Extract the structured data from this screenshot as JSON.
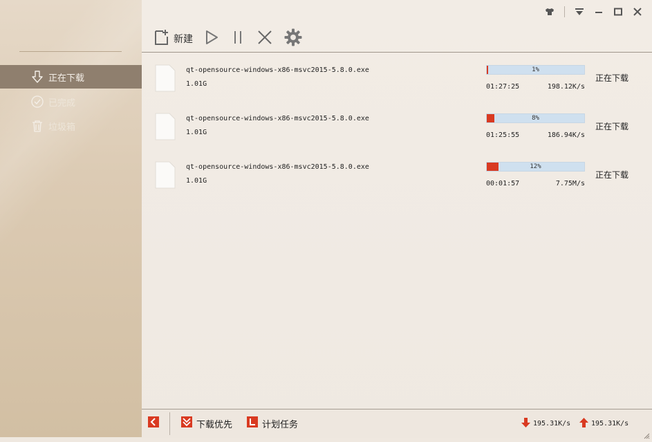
{
  "sidebar": {
    "items": [
      {
        "label": "正在下载",
        "icon": "download-icon",
        "active": true
      },
      {
        "label": "已完成",
        "icon": "check-circle-icon",
        "active": false
      },
      {
        "label": "垃圾箱",
        "icon": "trash-icon",
        "active": false
      }
    ]
  },
  "toolbar": {
    "new_label": "新建",
    "icons": [
      "new-file-icon",
      "play-icon",
      "pause-icon",
      "delete-icon",
      "gear-icon"
    ]
  },
  "window_controls": [
    "skin-icon",
    "menu-icon",
    "minimize-icon",
    "maximize-icon",
    "close-icon"
  ],
  "downloads": [
    {
      "name": "qt-opensource-windows-x86-msvc2015-5.8.0.exe",
      "size": "1.01G",
      "progress_pct": 1,
      "progress_label": "1%",
      "time": "01:27:25",
      "speed": "198.12K/s",
      "status": "正在下载"
    },
    {
      "name": "qt-opensource-windows-x86-msvc2015-5.8.0.exe",
      "size": "1.01G",
      "progress_pct": 8,
      "progress_label": "8%",
      "time": "01:25:55",
      "speed": "186.94K/s",
      "status": "正在下载"
    },
    {
      "name": "qt-opensource-windows-x86-msvc2015-5.8.0.exe",
      "size": "1.01G",
      "progress_pct": 12,
      "progress_label": "12%",
      "time": "00:01:57",
      "speed": "7.75M/s",
      "status": "正在下载"
    }
  ],
  "footer": {
    "priority_label": "下载优先",
    "schedule_label": "计划任务",
    "down_speed": "195.31K/s",
    "up_speed": "195.31K/s"
  },
  "colors": {
    "accent": "#d93a21",
    "progress_bg": "#cfe0ef",
    "sidebar_active": "#8f7f6e"
  }
}
